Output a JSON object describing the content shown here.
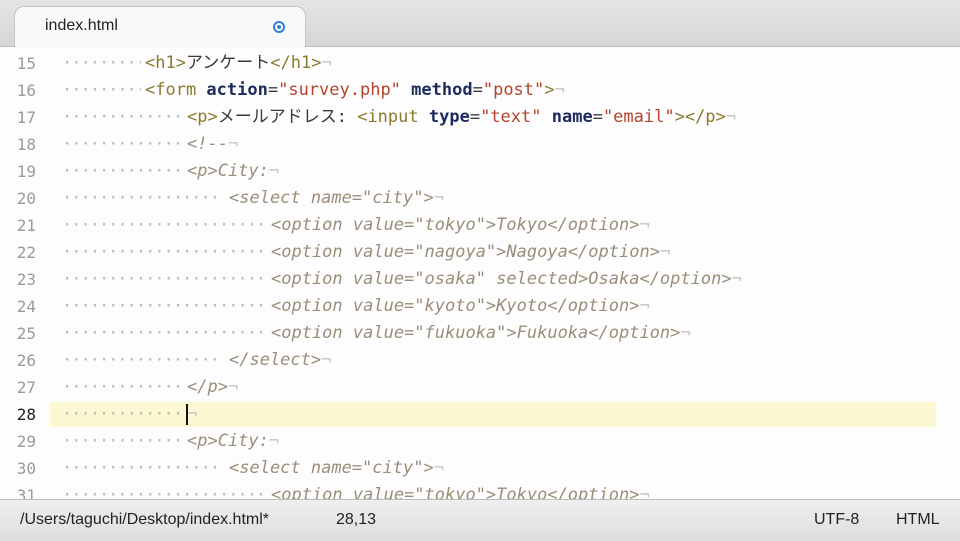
{
  "tab": {
    "title": "index.html"
  },
  "editor": {
    "lines": [
      {
        "num": "15",
        "dots": "·········",
        "indent": 145,
        "segs": [
          [
            "tag",
            "<h1>"
          ],
          [
            "txt",
            "アンケート"
          ],
          [
            "tag",
            "</h1>"
          ],
          [
            "eol",
            "¬"
          ]
        ]
      },
      {
        "num": "16",
        "dots": "·········",
        "indent": 145,
        "segs": [
          [
            "tag",
            "<form "
          ],
          [
            "attr",
            "action"
          ],
          [
            "txt",
            "="
          ],
          [
            "str",
            "\"survey.php\""
          ],
          [
            "txt",
            " "
          ],
          [
            "attr",
            "method"
          ],
          [
            "txt",
            "="
          ],
          [
            "str",
            "\"post\""
          ],
          [
            "tag",
            ">"
          ],
          [
            "eol",
            "¬"
          ]
        ]
      },
      {
        "num": "17",
        "dots": "·············",
        "indent": 187,
        "segs": [
          [
            "tag",
            "<p>"
          ],
          [
            "txt",
            "メールアドレス: "
          ],
          [
            "tag",
            "<input "
          ],
          [
            "attr",
            "type"
          ],
          [
            "txt",
            "="
          ],
          [
            "str",
            "\"text\""
          ],
          [
            "txt",
            " "
          ],
          [
            "attr",
            "name"
          ],
          [
            "txt",
            "="
          ],
          [
            "str",
            "\"email\""
          ],
          [
            "tag",
            "></p>"
          ],
          [
            "eol",
            "¬"
          ]
        ]
      },
      {
        "num": "18",
        "dots": "·············",
        "indent": 187,
        "segs": [
          [
            "cm",
            "<!--"
          ],
          [
            "eol",
            "¬"
          ]
        ]
      },
      {
        "num": "19",
        "dots": "·············",
        "indent": 187,
        "segs": [
          [
            "cm",
            "<p>City:"
          ],
          [
            "eol",
            "¬"
          ]
        ]
      },
      {
        "num": "20",
        "dots": "·················",
        "indent": 229,
        "segs": [
          [
            "cm",
            "<select name=\"city\">"
          ],
          [
            "eol",
            "¬"
          ]
        ]
      },
      {
        "num": "21",
        "dots": "·······················",
        "indent": 271,
        "segs": [
          [
            "cm",
            "<option value=\"tokyo\">Tokyo</option>"
          ],
          [
            "eol",
            "¬"
          ]
        ]
      },
      {
        "num": "22",
        "dots": "·······················",
        "indent": 271,
        "segs": [
          [
            "cm",
            "<option value=\"nagoya\">Nagoya</option>"
          ],
          [
            "eol",
            "¬"
          ]
        ]
      },
      {
        "num": "23",
        "dots": "·······················",
        "indent": 271,
        "segs": [
          [
            "cm",
            "<option value=\"osaka\" selected>Osaka</option>"
          ],
          [
            "eol",
            "¬"
          ]
        ]
      },
      {
        "num": "24",
        "dots": "·······················",
        "indent": 271,
        "segs": [
          [
            "cm",
            "<option value=\"kyoto\">Kyoto</option>"
          ],
          [
            "eol",
            "¬"
          ]
        ]
      },
      {
        "num": "25",
        "dots": "·······················",
        "indent": 271,
        "segs": [
          [
            "cm",
            "<option value=\"fukuoka\">Fukuoka</option>"
          ],
          [
            "eol",
            "¬"
          ]
        ]
      },
      {
        "num": "26",
        "dots": "·················",
        "indent": 229,
        "segs": [
          [
            "cm",
            "</select>"
          ],
          [
            "eol",
            "¬"
          ]
        ]
      },
      {
        "num": "27",
        "dots": "·············",
        "indent": 187,
        "segs": [
          [
            "cm",
            "</p>"
          ],
          [
            "eol",
            "¬"
          ]
        ]
      },
      {
        "num": "28",
        "dots": "·············",
        "indent": 187,
        "current": true,
        "segs": [
          [
            "eol",
            "¬"
          ]
        ]
      },
      {
        "num": "29",
        "dots": "·············",
        "indent": 187,
        "segs": [
          [
            "cm",
            "<p>City:"
          ],
          [
            "eol",
            "¬"
          ]
        ]
      },
      {
        "num": "30",
        "dots": "·················",
        "indent": 229,
        "segs": [
          [
            "cm",
            "<select name=\"city\">"
          ],
          [
            "eol",
            "¬"
          ]
        ]
      },
      {
        "num": "31",
        "dots": "·······················",
        "indent": 271,
        "segs": [
          [
            "cm",
            "<option value=\"tokyo\">Tokyo</option>"
          ],
          [
            "eol",
            "¬"
          ]
        ]
      }
    ]
  },
  "status": {
    "path": "/Users/taguchi/Desktop/index.html*",
    "cursor": "28,13",
    "encoding": "UTF-8",
    "syntax": "HTML"
  },
  "colors": {
    "current_line": "#fbf8d2",
    "tag": "#8a7a2e",
    "attribute": "#1c2b5e",
    "string": "#b5432b",
    "comment": "#9a8e7a",
    "modified_dot": "#2f7fe0"
  }
}
